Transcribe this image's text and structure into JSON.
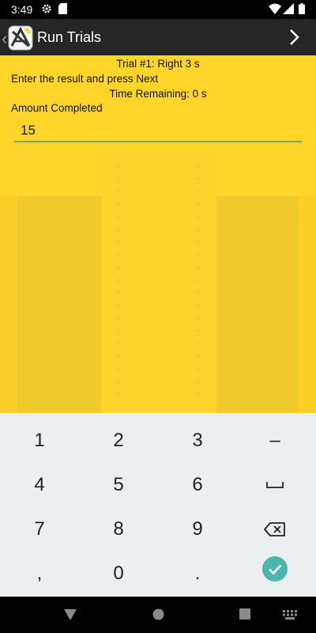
{
  "status_bar": {
    "time": "3:49"
  },
  "app_bar": {
    "title": "Run Trials"
  },
  "content": {
    "trial_line": "Trial #1: Right 3 s",
    "instruction": "Enter the result and press Next",
    "time_remaining": "Time Remaining: 0 s",
    "field_label": "Amount Completed",
    "amount_value": "15"
  },
  "keyboard": {
    "keys": [
      "1",
      "2",
      "3",
      "−",
      "4",
      "5",
      "6",
      "␣",
      "7",
      "8",
      "9",
      "⌫",
      ",",
      "0",
      ".",
      "✓"
    ],
    "digits": {
      "k1": "1",
      "k2": "2",
      "k3": "3",
      "k4": "4",
      "k5": "5",
      "k6": "6",
      "k7": "7",
      "k8": "8",
      "k9": "9",
      "k0": "0"
    },
    "minus": "–",
    "comma": ",",
    "period": "."
  },
  "icons": {
    "status": [
      "settings-icon",
      "sd-card-icon",
      "wifi-icon",
      "signal-icon",
      "battery-icon"
    ],
    "nav": [
      "back-triangle-icon",
      "home-circle-icon",
      "recents-square-icon",
      "keyboard-switch-icon"
    ]
  },
  "colors": {
    "app_background": "#FFD52A",
    "app_bar": "#262626",
    "accent": "#4DB6AC",
    "keyboard": "#ECEFF1"
  }
}
